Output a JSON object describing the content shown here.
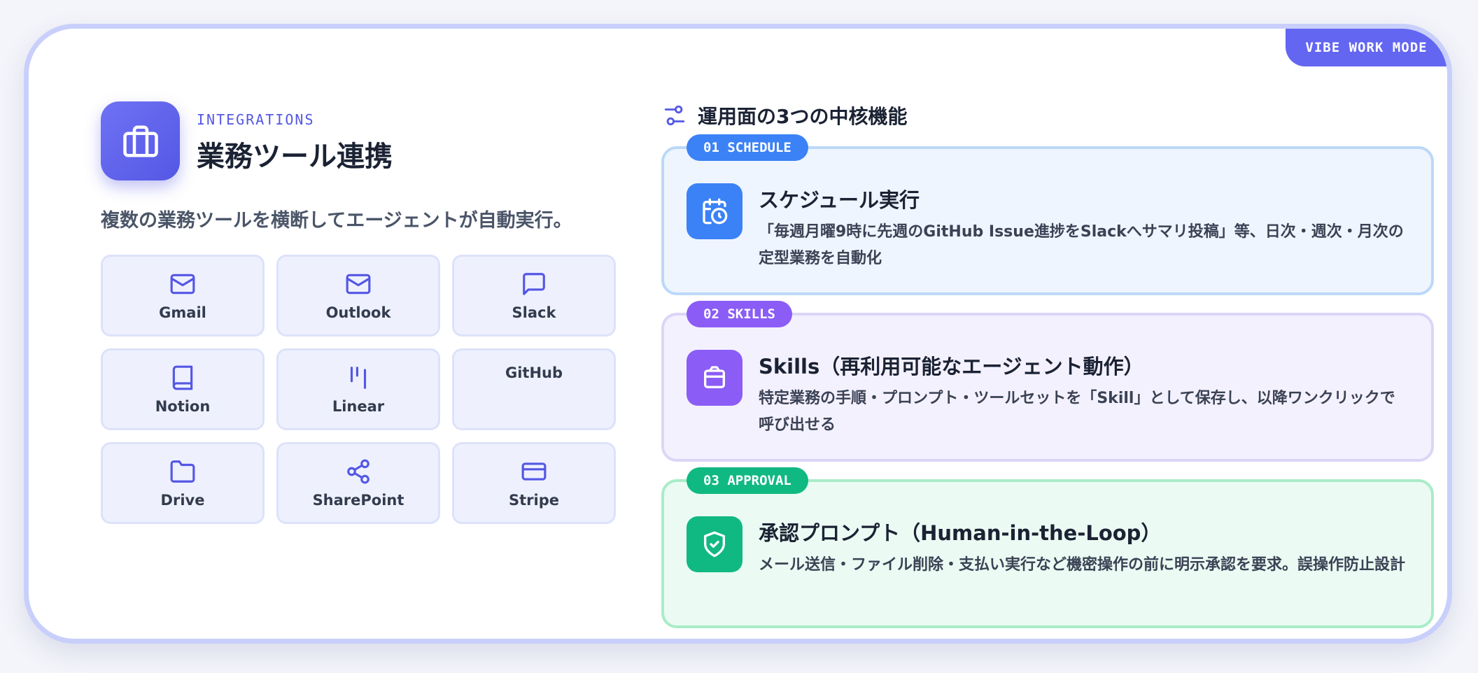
{
  "badge": "VIBE WORK MODE",
  "header": {
    "eyebrow": "INTEGRATIONS",
    "title": "業務ツール連携",
    "icon": "briefcase-icon"
  },
  "subtitle": "複数の業務ツールを横断してエージェントが自動実行。",
  "tools": [
    {
      "label": "Gmail",
      "icon": "mail-icon"
    },
    {
      "label": "Outlook",
      "icon": "mail-icon"
    },
    {
      "label": "Slack",
      "icon": "message-square-icon"
    },
    {
      "label": "Notion",
      "icon": "book-icon"
    },
    {
      "label": "Linear",
      "icon": "linear-icon"
    },
    {
      "label": "GitHub",
      "icon": ""
    },
    {
      "label": "Drive",
      "icon": "folder-icon"
    },
    {
      "label": "SharePoint",
      "icon": "share-icon"
    },
    {
      "label": "Stripe",
      "icon": "credit-card-icon"
    }
  ],
  "section": {
    "title": "運用面の3つの中核機能",
    "icon": "sliders-icon"
  },
  "features": [
    {
      "tag": "01 SCHEDULE",
      "title": "スケジュール実行",
      "desc": "「毎週月曜9時に先週のGitHub Issue進捗をSlackへサマリ投稿」等、日次・週次・月次の定型業務を自動化",
      "icon": "calendar-clock-icon",
      "accent": "#3b82f6"
    },
    {
      "tag": "02 SKILLS",
      "title": "Skills（再利用可能なエージェント動作）",
      "desc": "特定業務の手順・プロンプト・ツールセットを「Skill」として保存し、以降ワンクリックで呼び出せる",
      "icon": "package-icon",
      "accent": "#8b5cf6"
    },
    {
      "tag": "03 APPROVAL",
      "title": "承認プロンプト（Human-in-the-Loop）",
      "desc": "メール送信・ファイル削除・支払い実行など機密操作の前に明示承認を要求。誤操作防止設計",
      "icon": "shield-check-icon",
      "accent": "#10b981"
    }
  ]
}
